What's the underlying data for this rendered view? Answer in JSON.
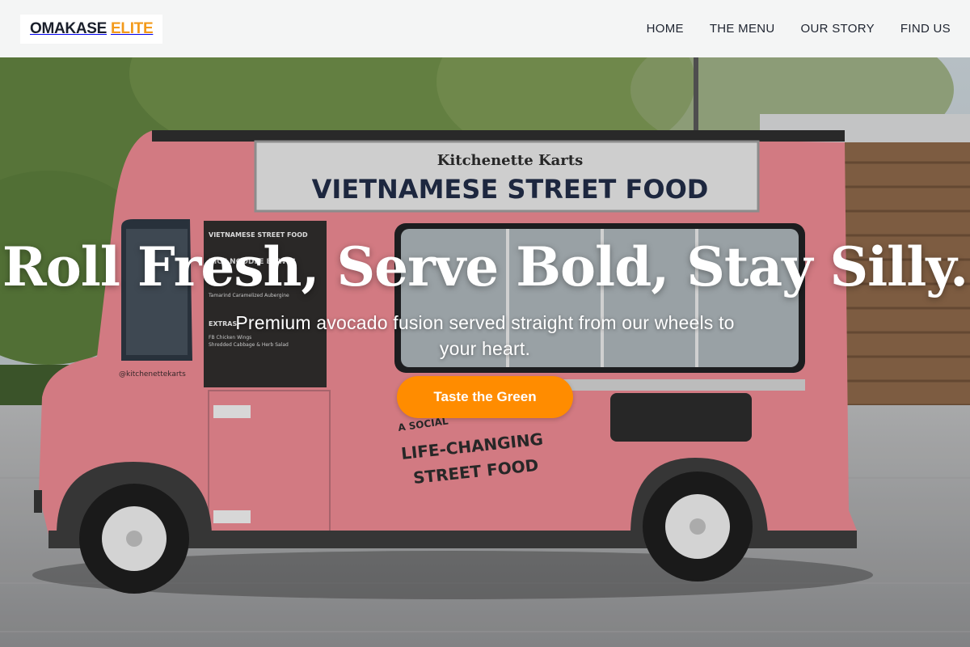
{
  "brand": {
    "name_part1": "OMAKASE",
    "name_part2": "ELITE",
    "accent_color": "#f39a1a"
  },
  "nav": {
    "items": [
      {
        "label": "HOME"
      },
      {
        "label": "THE MENU"
      },
      {
        "label": "OUR STORY"
      },
      {
        "label": "FIND US"
      }
    ]
  },
  "hero": {
    "headline": "Roll Fresh, Serve Bold, Stay Silly.",
    "subheadline": "Premium avocado fusion served straight from our wheels to your heart.",
    "cta_label": "Taste the Green",
    "cta_color": "#ff8c00",
    "truck_color": "#e8868f",
    "truck_sign_top": "Kitchenette Karts",
    "truck_sign_main": "VIETNAMESE STREET FOOD",
    "truck_side_slogan_small": "A SOCIAL",
    "truck_side_slogan_1": "LIFE-CHANGING",
    "truck_side_slogan_2": "STREET FOOD",
    "truck_handle": "@kitchenettekarts",
    "menu_board": {
      "title": "VIETNAMESE STREET FOOD",
      "section_1": "RICE NOODLE BOWLS",
      "item_1": "Tamarind Caramelized Aubergine",
      "section_2": "EXTRAS",
      "item_2": "FB Chicken Wings",
      "item_3": "Shredded Cabbage & Herb Salad"
    }
  }
}
